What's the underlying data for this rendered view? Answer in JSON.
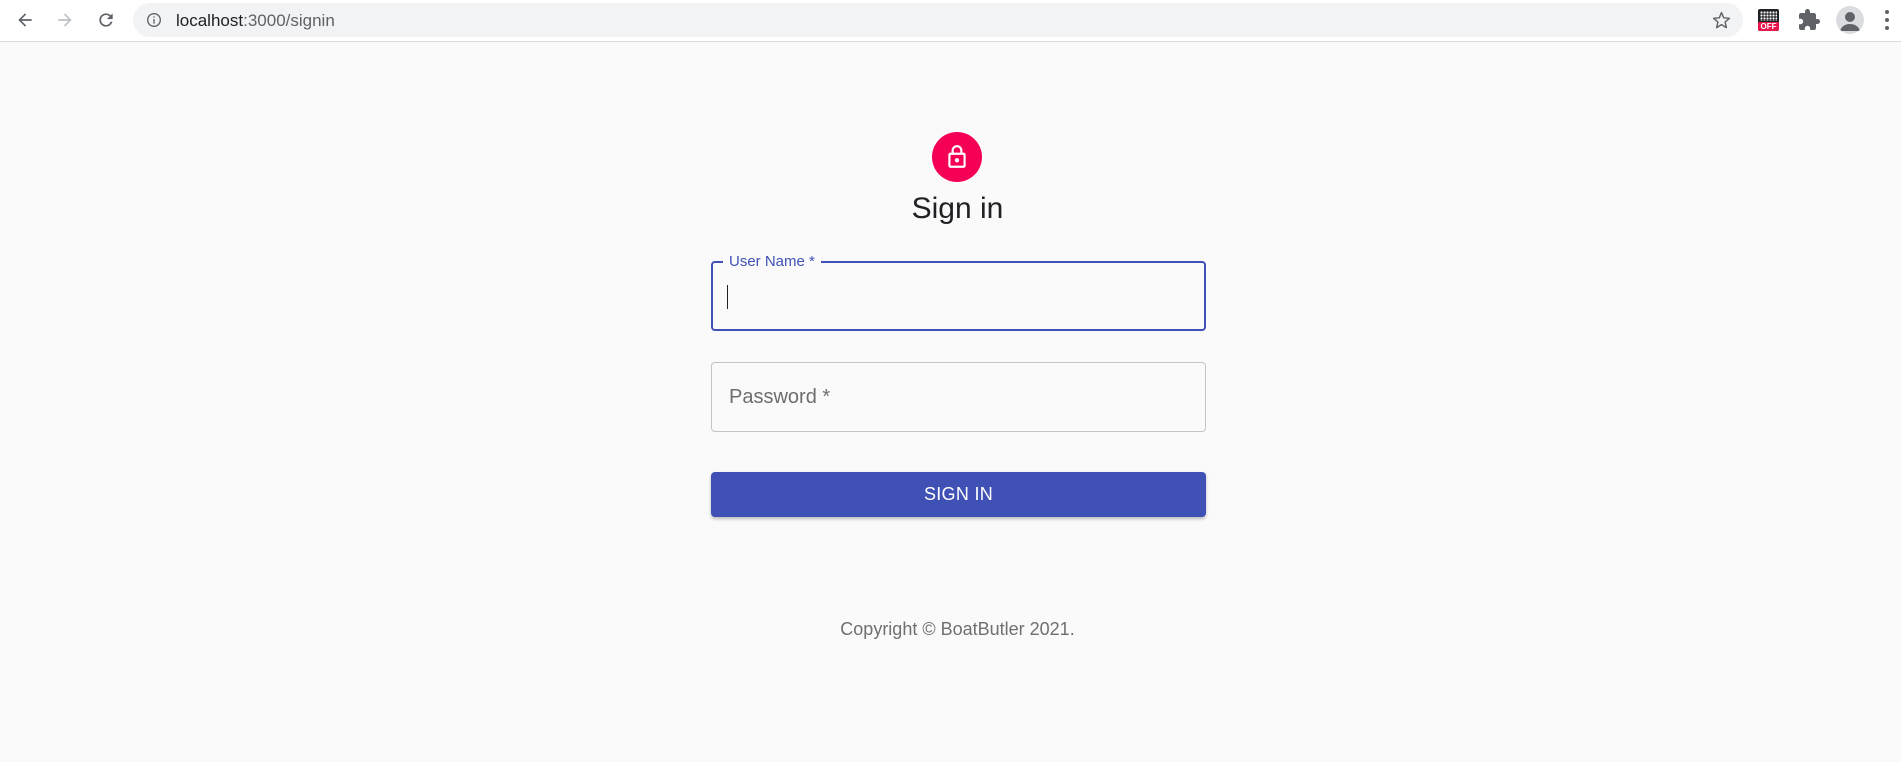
{
  "browser": {
    "url_host": "localhost",
    "url_path": ":3000/signin",
    "extension_badge": "OFF"
  },
  "page": {
    "title": "Sign in",
    "username_label": "User Name *",
    "password_placeholder": "Password *",
    "signin_button": "SIGN IN",
    "copyright": "Copyright © BoatButler 2021."
  },
  "colors": {
    "primary": "#3f51b5",
    "secondary": "#f50057",
    "background": "#fafafa"
  }
}
